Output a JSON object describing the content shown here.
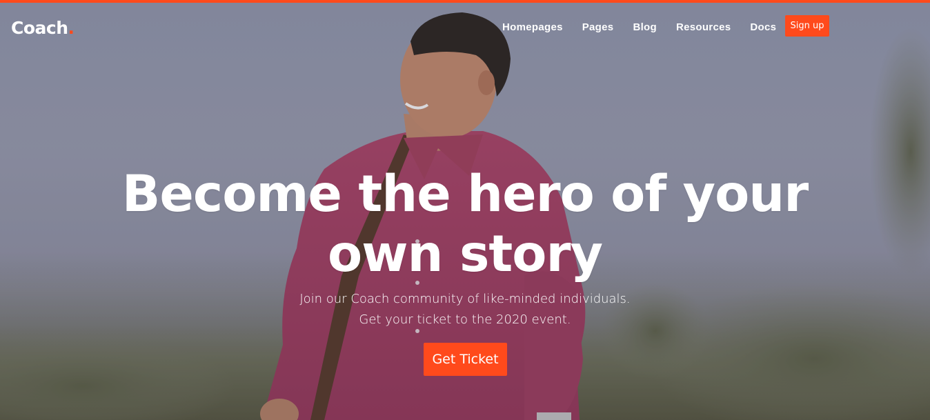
{
  "brand": {
    "name": "Coach",
    "dot": ".",
    "accent_color": "#ff4a1c"
  },
  "nav": {
    "items": [
      {
        "label": "Homepages"
      },
      {
        "label": "Pages"
      },
      {
        "label": "Blog"
      },
      {
        "label": "Resources"
      },
      {
        "label": "Docs"
      }
    ],
    "signup_label": "Sign up"
  },
  "hero": {
    "title_line1": "Become the hero of your",
    "title_line2": "own story",
    "subtitle_line1": "Join our Coach community of like-minded individuals.",
    "subtitle_line2": "Get your ticket to the 2020 event.",
    "cta_label": "Get Ticket",
    "background_image": "smiling-man-pink-shirt-outdoors"
  }
}
